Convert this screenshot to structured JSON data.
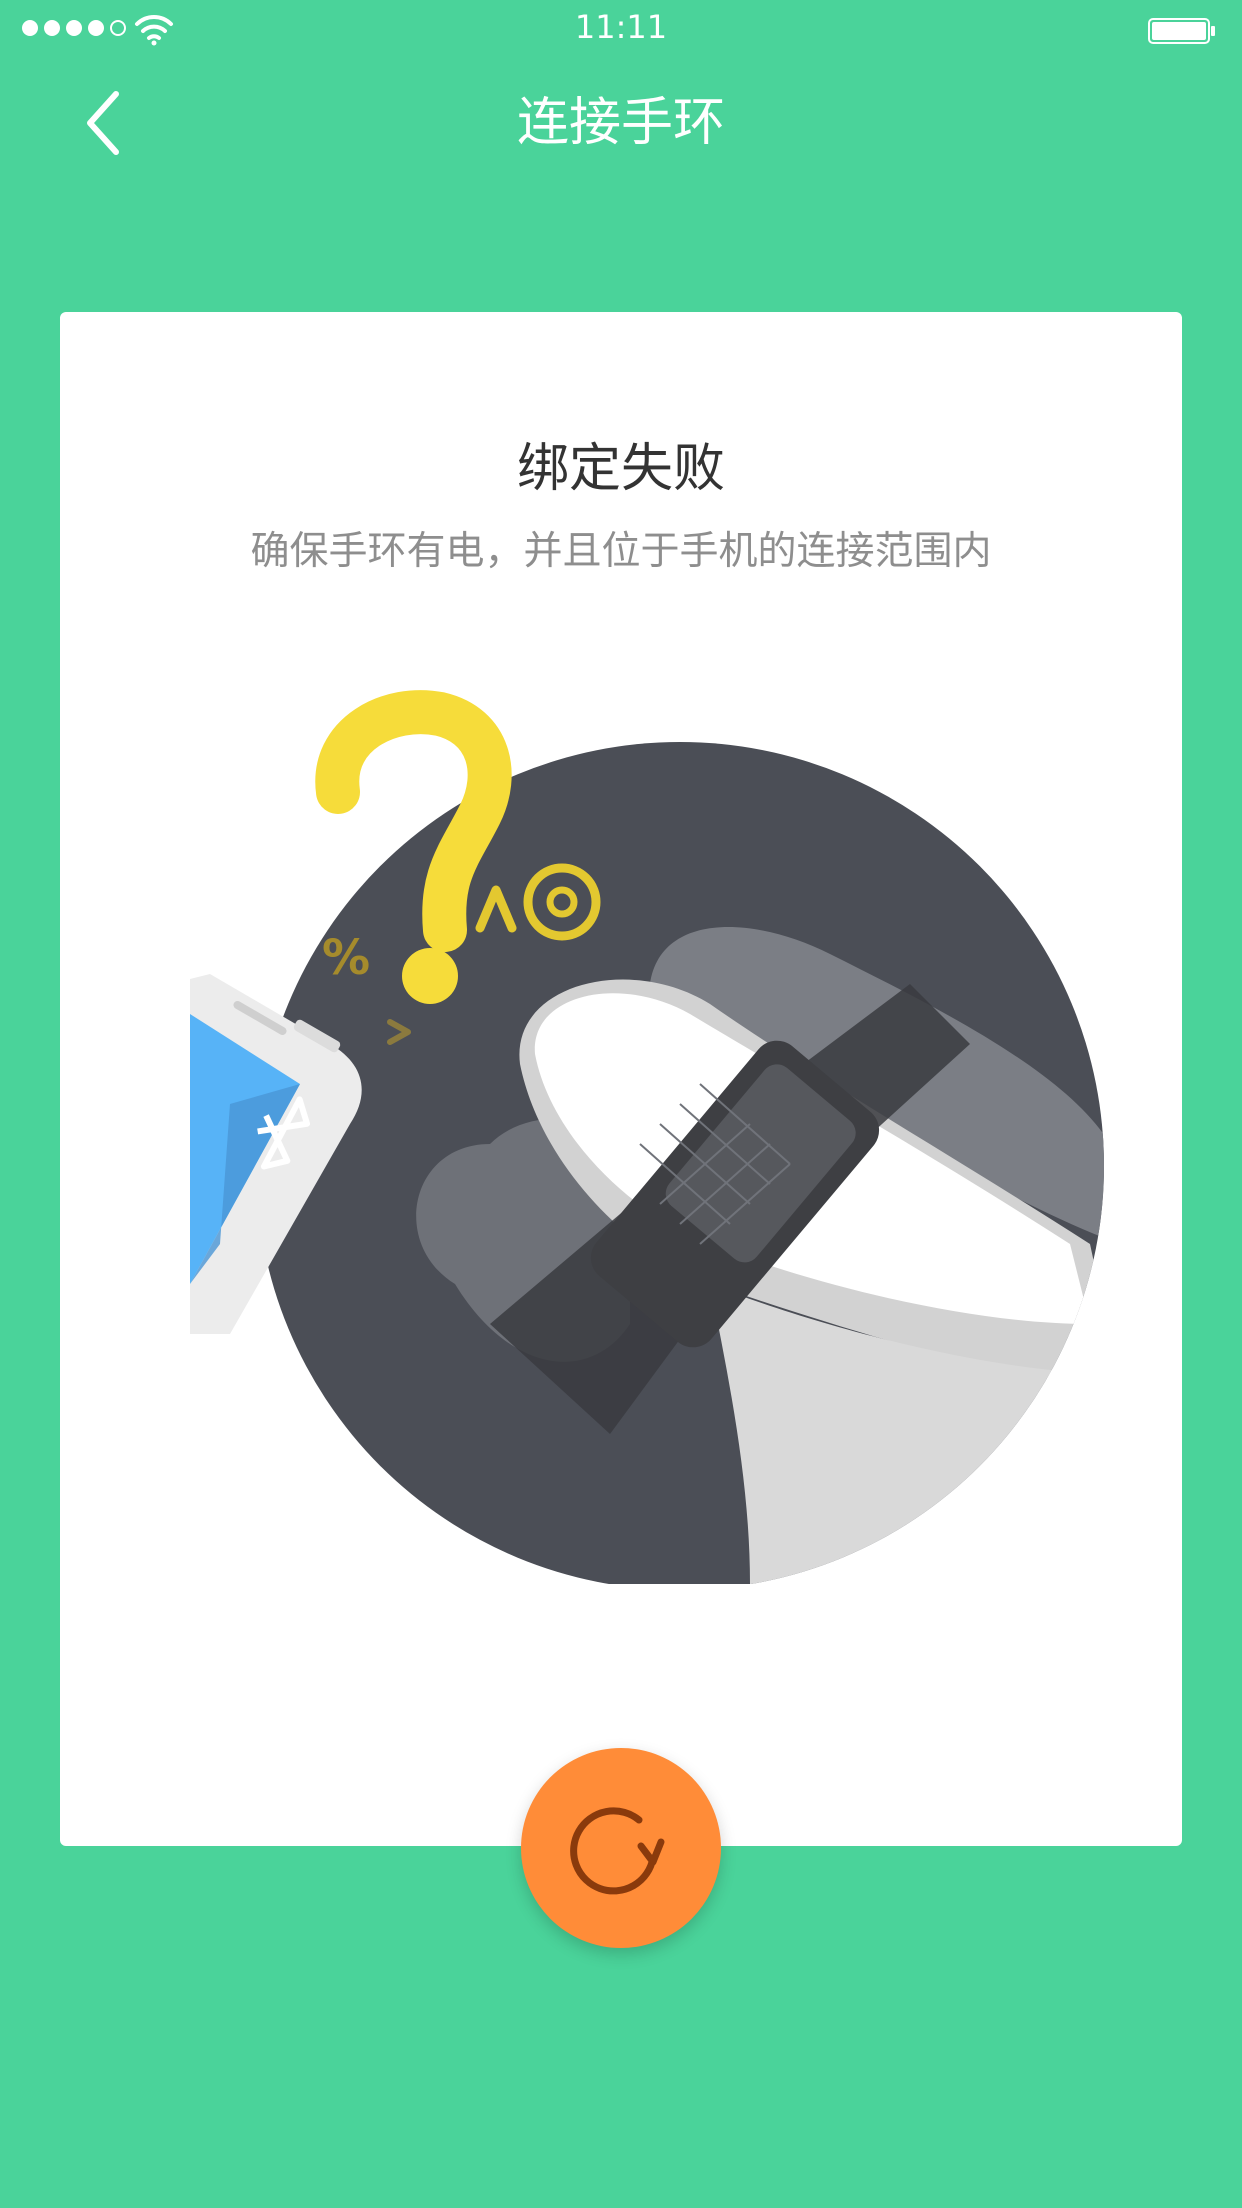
{
  "status_bar": {
    "time": "11:11",
    "signal_icon": "signal-dots-icon",
    "wifi_icon": "wifi-icon",
    "battery_icon": "battery-icon"
  },
  "nav": {
    "back_icon": "chevron-left-icon",
    "title": "连接手环"
  },
  "card": {
    "title": "绑定失败",
    "subtitle": "确保手环有电，并且位于手机的连接范围内",
    "illustration": {
      "symbols": [
        "?",
        "^",
        "@",
        "%",
        ">"
      ],
      "bluetooth_icon": "bluetooth-icon"
    }
  },
  "retry_button": {
    "icon": "refresh-icon"
  },
  "colors": {
    "background": "#4ad39a",
    "card": "#ffffff",
    "circle": "#4b4e56",
    "accent_yellow": "#f6dc3a",
    "retry": "#ff8c38",
    "phone_screen": "#57b3f7"
  }
}
